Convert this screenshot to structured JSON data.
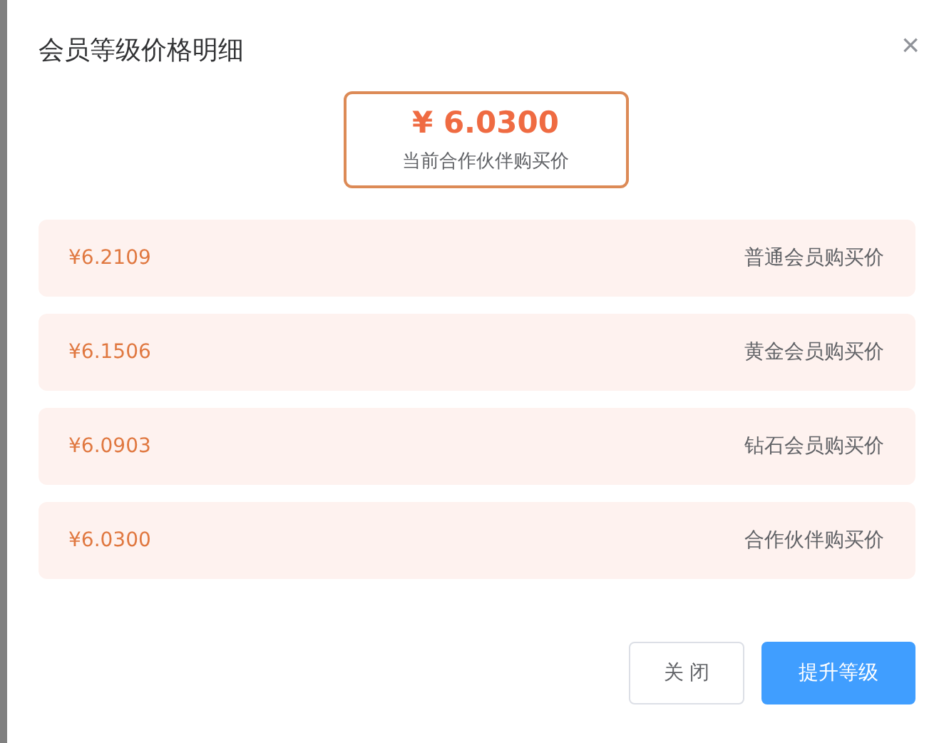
{
  "dialog": {
    "title": "会员等级价格明细",
    "close_icon": "×"
  },
  "current": {
    "price": "¥ 6.0300",
    "label": "当前合作伙伴购买价"
  },
  "tiers": [
    {
      "price": "¥6.2109",
      "label": "普通会员购买价"
    },
    {
      "price": "¥6.1506",
      "label": "黄金会员购买价"
    },
    {
      "price": "¥6.0903",
      "label": "钻石会员购买价"
    },
    {
      "price": "¥6.0300",
      "label": "合作伙伴购买价"
    }
  ],
  "buttons": [
    {
      "label": "关 闭",
      "kind": "default"
    },
    {
      "label": "提升等级",
      "kind": "primary"
    }
  ]
}
